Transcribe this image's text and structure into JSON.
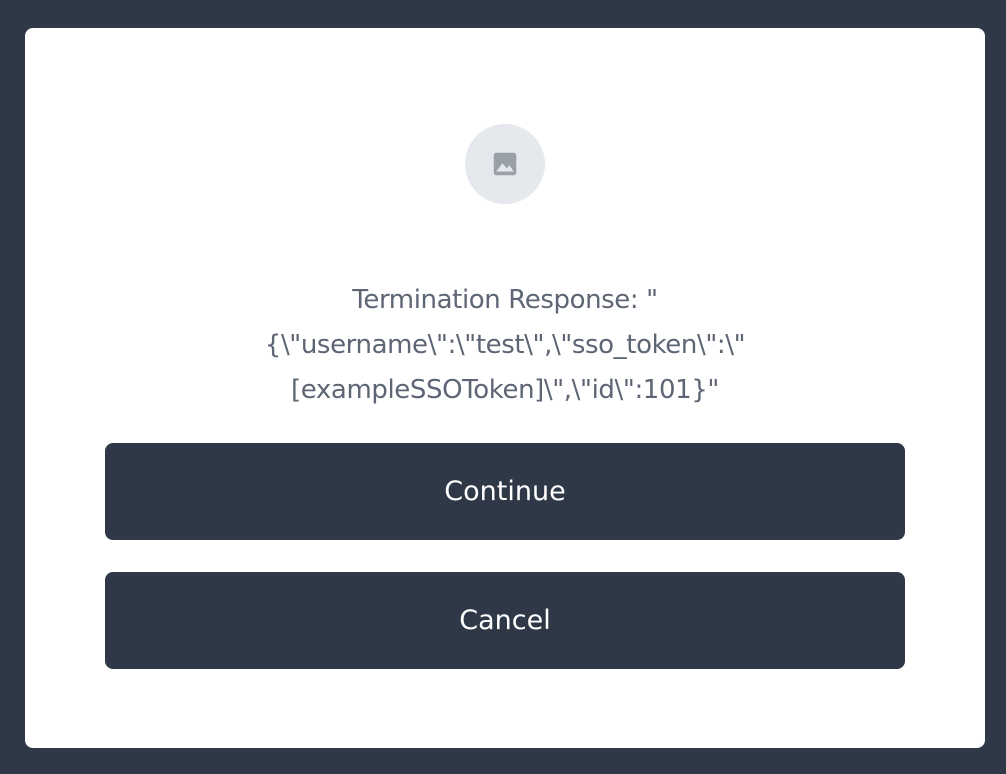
{
  "dialog": {
    "icon": "image-placeholder-icon",
    "message_lines": [
      "Termination Response: \"",
      "{\\\"username\\\":\\\"test\\\",\\\"sso_token\\\":\\\"",
      "[exampleSSOToken]\\\",\\\"id\\\":101}\""
    ],
    "continue_label": "Continue",
    "cancel_label": "Cancel"
  },
  "colors": {
    "backdrop": "#2f3847",
    "modal": "#ffffff",
    "button": "#2f3847",
    "button_text": "#ffffff",
    "message_text": "#5e6675",
    "icon_bg": "#e5e8ec",
    "icon_fg": "#9aa0a8"
  }
}
